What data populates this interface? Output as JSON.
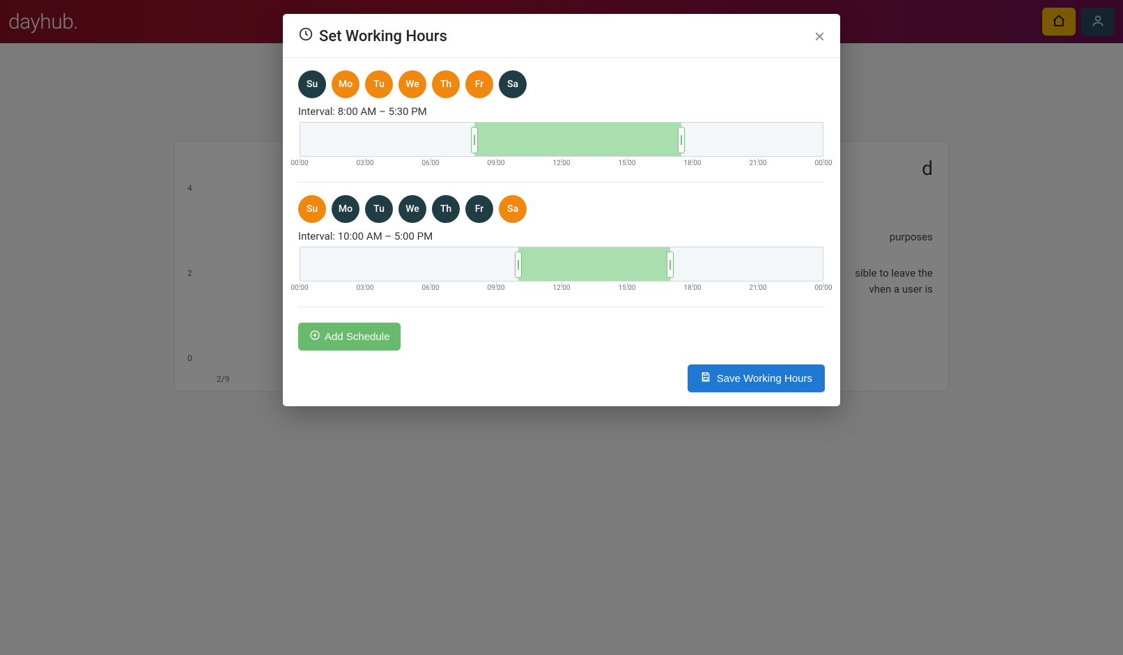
{
  "app": {
    "name": "dayhub."
  },
  "modal": {
    "title": "Set Working Hours",
    "close_label": "×",
    "add_button": "Add Schedule",
    "save_button": "Save Working Hours",
    "day_labels": [
      "Su",
      "Mo",
      "Tu",
      "We",
      "Th",
      "Fr",
      "Sa"
    ],
    "tick_labels": [
      "00:00",
      "03:00",
      "06:00",
      "09:00",
      "12:00",
      "15:00",
      "18:00",
      "21:00",
      "00:00"
    ],
    "schedules": [
      {
        "active_days": [
          false,
          true,
          true,
          true,
          true,
          true,
          false
        ],
        "interval_label": "Interval: 8:00 AM – 5:30 PM",
        "start_pct": 33.33,
        "end_pct": 72.92
      },
      {
        "active_days": [
          true,
          false,
          false,
          false,
          false,
          false,
          true
        ],
        "interval_label": "Interval: 10:00 AM – 5:00 PM",
        "start_pct": 41.67,
        "end_pct": 70.83
      }
    ]
  },
  "bg": {
    "title_fragment": "d",
    "y_ticks": [
      "4",
      "2",
      "0"
    ],
    "x_tick": "2/9",
    "line1": "purposes",
    "line2a": "sible to leave the",
    "line2b": "vhen a user is"
  },
  "colors": {
    "day_active": "#f0880f",
    "day_inactive": "#203c44",
    "range": "#9bdba0",
    "add_btn": "#68bb6c",
    "save_btn": "#1f78d1"
  }
}
